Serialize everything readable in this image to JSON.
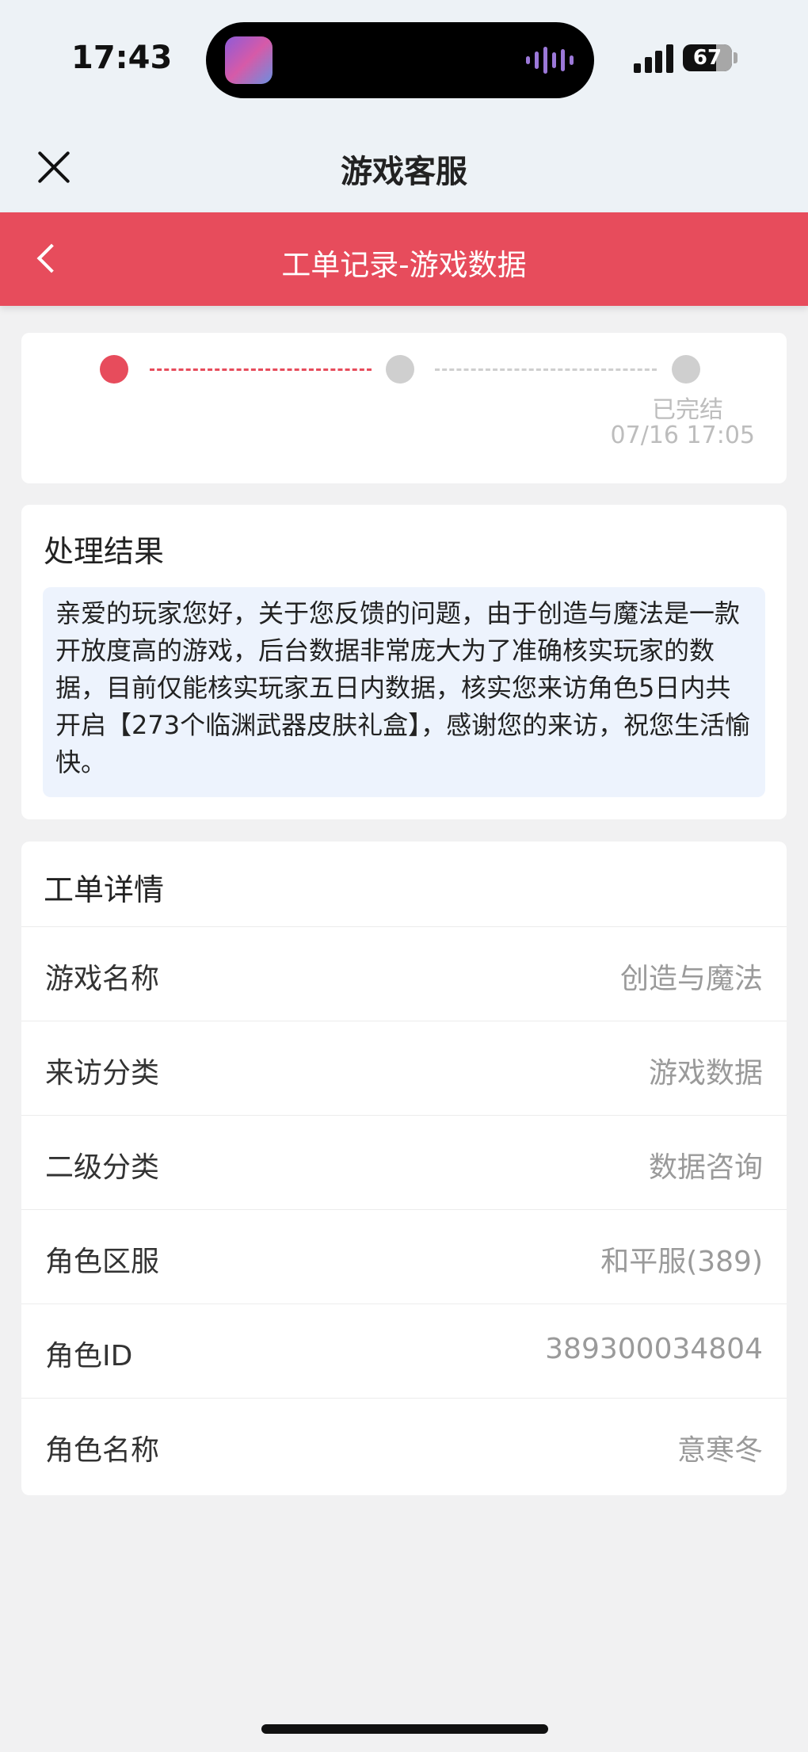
{
  "status": {
    "time": "17:43",
    "battery": "67"
  },
  "title_bar": {
    "title": "游戏客服"
  },
  "header": {
    "title": "工单记录-游戏数据",
    "accent": "#e74c5c"
  },
  "progress": {
    "final_step_label": "已完结",
    "final_step_time": "07/16 17:05",
    "current_step": 1,
    "total_steps": 3
  },
  "result": {
    "title": "处理结果",
    "text": "亲爱的玩家您好，关于您反馈的问题，由于创造与魔法是一款开放度高的游戏，后台数据非常庞大为了准确核实玩家的数据，目前仅能核实玩家五日内数据，核实您来访角色5日内共开启【273个临渊武器皮肤礼盒】，感谢您的来访，祝您生活愉快。"
  },
  "details": {
    "title": "工单详情",
    "rows": [
      {
        "label": "游戏名称",
        "value": "创造与魔法"
      },
      {
        "label": "来访分类",
        "value": "游戏数据"
      },
      {
        "label": "二级分类",
        "value": "数据咨询"
      },
      {
        "label": "角色区服",
        "value": "和平服(389)"
      },
      {
        "label": "角色ID",
        "value": "389300034804"
      },
      {
        "label": "角色名称",
        "value": "意寒冬"
      }
    ]
  }
}
